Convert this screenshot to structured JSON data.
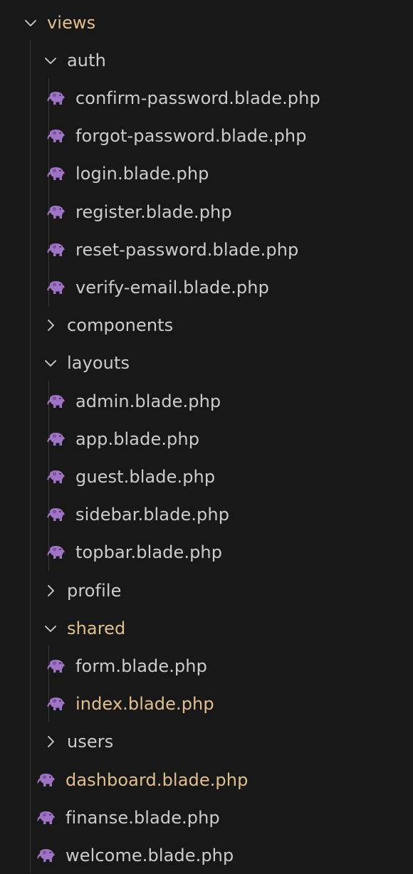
{
  "explorer": {
    "colors": {
      "background": "#181818",
      "text": "#cccccc",
      "modified_text": "#e2c08d",
      "php_icon": "#a074c4",
      "chevron": "#cccccc",
      "indent_guide": "#3a3a3a"
    },
    "tree": [
      {
        "type": "folder",
        "name": "views",
        "expanded": true,
        "depth": 0,
        "modified": true,
        "icon": "chevron-down-icon"
      },
      {
        "type": "folder",
        "name": "auth",
        "expanded": true,
        "depth": 1,
        "modified": false,
        "icon": "chevron-down-icon"
      },
      {
        "type": "file",
        "name": "confirm-password.blade.php",
        "depth": 2,
        "modified": false,
        "icon": "php-elephant-icon"
      },
      {
        "type": "file",
        "name": "forgot-password.blade.php",
        "depth": 2,
        "modified": false,
        "icon": "php-elephant-icon"
      },
      {
        "type": "file",
        "name": "login.blade.php",
        "depth": 2,
        "modified": false,
        "icon": "php-elephant-icon"
      },
      {
        "type": "file",
        "name": "register.blade.php",
        "depth": 2,
        "modified": false,
        "icon": "php-elephant-icon"
      },
      {
        "type": "file",
        "name": "reset-password.blade.php",
        "depth": 2,
        "modified": false,
        "icon": "php-elephant-icon"
      },
      {
        "type": "file",
        "name": "verify-email.blade.php",
        "depth": 2,
        "modified": false,
        "icon": "php-elephant-icon"
      },
      {
        "type": "folder",
        "name": "components",
        "expanded": false,
        "depth": 1,
        "modified": false,
        "icon": "chevron-right-icon"
      },
      {
        "type": "folder",
        "name": "layouts",
        "expanded": true,
        "depth": 1,
        "modified": false,
        "icon": "chevron-down-icon"
      },
      {
        "type": "file",
        "name": "admin.blade.php",
        "depth": 2,
        "modified": false,
        "icon": "php-elephant-icon"
      },
      {
        "type": "file",
        "name": "app.blade.php",
        "depth": 2,
        "modified": false,
        "icon": "php-elephant-icon"
      },
      {
        "type": "file",
        "name": "guest.blade.php",
        "depth": 2,
        "modified": false,
        "icon": "php-elephant-icon"
      },
      {
        "type": "file",
        "name": "sidebar.blade.php",
        "depth": 2,
        "modified": false,
        "icon": "php-elephant-icon"
      },
      {
        "type": "file",
        "name": "topbar.blade.php",
        "depth": 2,
        "modified": false,
        "icon": "php-elephant-icon"
      },
      {
        "type": "folder",
        "name": "profile",
        "expanded": false,
        "depth": 1,
        "modified": false,
        "icon": "chevron-right-icon"
      },
      {
        "type": "folder",
        "name": "shared",
        "expanded": true,
        "depth": 1,
        "modified": true,
        "icon": "chevron-down-icon"
      },
      {
        "type": "file",
        "name": "form.blade.php",
        "depth": 2,
        "modified": false,
        "icon": "php-elephant-icon"
      },
      {
        "type": "file",
        "name": "index.blade.php",
        "depth": 2,
        "modified": true,
        "icon": "php-elephant-icon"
      },
      {
        "type": "folder",
        "name": "users",
        "expanded": false,
        "depth": 1,
        "modified": false,
        "icon": "chevron-right-icon"
      },
      {
        "type": "file",
        "name": "dashboard.blade.php",
        "depth": 1,
        "modified": true,
        "icon": "php-elephant-icon"
      },
      {
        "type": "file",
        "name": "finanse.blade.php",
        "depth": 1,
        "modified": false,
        "icon": "php-elephant-icon"
      },
      {
        "type": "file",
        "name": "welcome.blade.php",
        "depth": 1,
        "modified": false,
        "icon": "php-elephant-icon"
      }
    ]
  }
}
